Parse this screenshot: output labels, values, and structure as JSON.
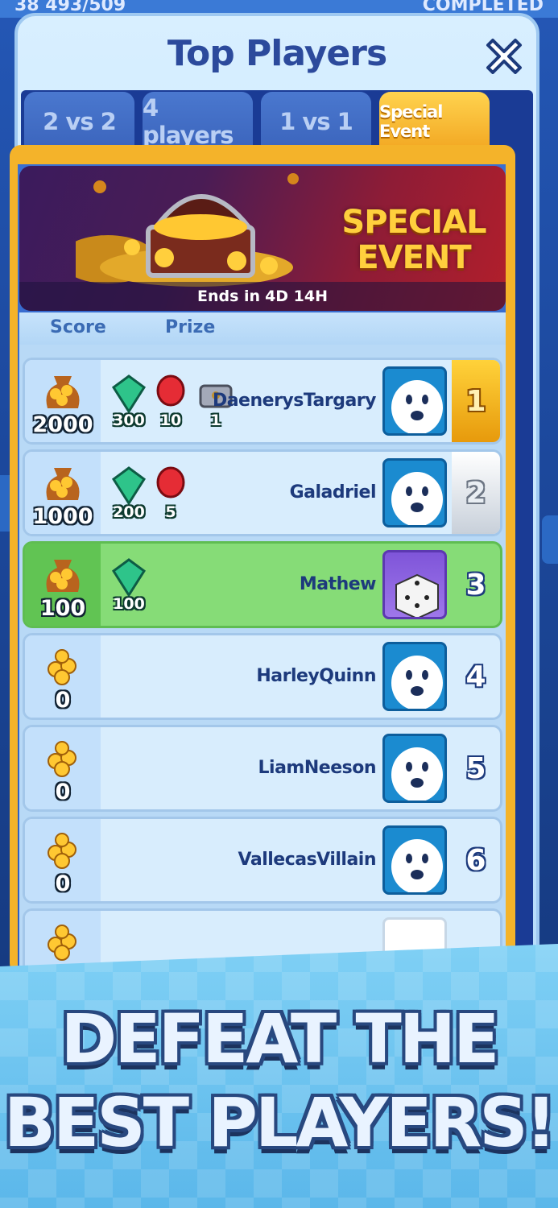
{
  "background": {
    "top_left_text": "38 493/509",
    "top_right_text": "COMPLETED"
  },
  "panel": {
    "title": "Top Players",
    "close_icon": "close-icon"
  },
  "tabs": [
    {
      "label": "2 vs 2",
      "active": false
    },
    {
      "label": "4 players",
      "active": false
    },
    {
      "label": "1 vs 1",
      "active": false
    },
    {
      "label": "Special Event",
      "active": true
    }
  ],
  "banner": {
    "title_line1": "SPECIAL",
    "title_line2": "EVENT",
    "ends_label": "Ends in",
    "ends_value": "4D 14H"
  },
  "columns": {
    "score": "Score",
    "prize": "Prize"
  },
  "rows": [
    {
      "score": "2000",
      "name": "DaenerysTargary",
      "rank": "1",
      "prizes": [
        {
          "type": "gem",
          "amount": "300"
        },
        {
          "type": "glove",
          "amount": "10"
        },
        {
          "type": "chest",
          "amount": "1"
        }
      ],
      "avatar": "smiley-avatar",
      "highlight": false
    },
    {
      "score": "1000",
      "name": "Galadriel",
      "rank": "2",
      "prizes": [
        {
          "type": "gem",
          "amount": "200"
        },
        {
          "type": "glove",
          "amount": "5"
        }
      ],
      "avatar": "smiley-avatar",
      "highlight": false
    },
    {
      "score": "100",
      "name": "Mathew",
      "rank": "3",
      "prizes": [
        {
          "type": "gem",
          "amount": "100"
        }
      ],
      "avatar": "dice-avatar",
      "highlight": true
    },
    {
      "score": "0",
      "name": "HarleyQuinn",
      "rank": "4",
      "prizes": [],
      "avatar": "smiley-avatar",
      "highlight": false
    },
    {
      "score": "0",
      "name": "LiamNeeson",
      "rank": "5",
      "prizes": [],
      "avatar": "smiley-avatar",
      "highlight": false
    },
    {
      "score": "0",
      "name": "VallecasVillain",
      "rank": "6",
      "prizes": [],
      "avatar": "smiley-avatar",
      "highlight": false
    }
  ],
  "footer": {
    "line1": "DEFEAT THE",
    "line2": "BEST PLAYERS!"
  },
  "colors": {
    "title": "#2c4a9c",
    "active_tab": "#f2a621",
    "highlight_row": "#86dc77",
    "gold_rank": "#ffd23a"
  }
}
